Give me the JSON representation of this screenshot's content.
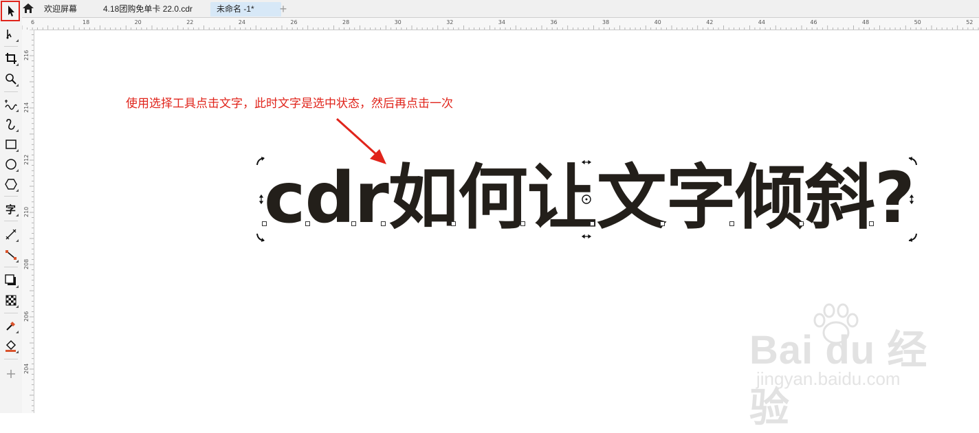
{
  "tabs": {
    "home_icon": "home-icon",
    "welcome": "欢迎屏幕",
    "file": "4.18团购免单卡 22.0.cdr",
    "active": "未命名 -1*",
    "add": "+"
  },
  "ruler": {
    "h_labels": [
      "6",
      "18",
      "20",
      "22",
      "24",
      "26",
      "28",
      "30",
      "32",
      "34",
      "36",
      "38",
      "40",
      "42",
      "44",
      "46",
      "48",
      "50",
      "52"
    ],
    "v_labels": [
      "216",
      "214",
      "212",
      "210",
      "208",
      "206",
      "204"
    ]
  },
  "canvas": {
    "annotation": "使用选择工具点击文字，此时文字是选中状态，然后再点击一次",
    "headline": "cdr如何让文字倾斜?"
  },
  "watermark": {
    "brand": "Bai du 经验",
    "url": "jingyan.baidu.com"
  },
  "colors": {
    "annotation": "#e0241b",
    "highlight": "#e0241b",
    "active_tab": "#d7e8f7",
    "headline": "#231f1a"
  },
  "tools": [
    "pick-tool-icon",
    "shape-tool-icon",
    "crop-tool-icon",
    "zoom-tool-icon",
    "freehand-tool-icon",
    "artistic-media-icon",
    "rectangle-tool-icon",
    "ellipse-tool-icon",
    "polygon-tool-icon",
    "text-tool-icon",
    "dimension-tool-icon",
    "connector-tool-icon",
    "drop-shadow-icon",
    "transparency-icon",
    "eyedropper-icon",
    "fill-tool-icon",
    "add-tool-icon"
  ]
}
